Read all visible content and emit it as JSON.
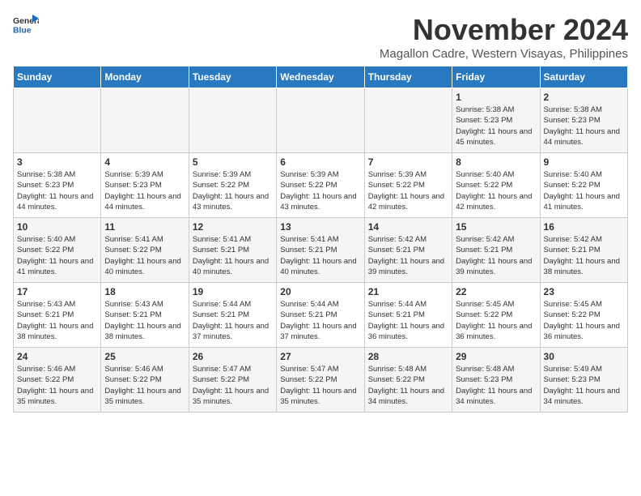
{
  "logo": {
    "line1": "General",
    "line2": "Blue"
  },
  "title": "November 2024",
  "location": "Magallon Cadre, Western Visayas, Philippines",
  "weekdays": [
    "Sunday",
    "Monday",
    "Tuesday",
    "Wednesday",
    "Thursday",
    "Friday",
    "Saturday"
  ],
  "weeks": [
    [
      {
        "day": "",
        "info": ""
      },
      {
        "day": "",
        "info": ""
      },
      {
        "day": "",
        "info": ""
      },
      {
        "day": "",
        "info": ""
      },
      {
        "day": "",
        "info": ""
      },
      {
        "day": "1",
        "info": "Sunrise: 5:38 AM\nSunset: 5:23 PM\nDaylight: 11 hours and 45 minutes."
      },
      {
        "day": "2",
        "info": "Sunrise: 5:38 AM\nSunset: 5:23 PM\nDaylight: 11 hours and 44 minutes."
      }
    ],
    [
      {
        "day": "3",
        "info": "Sunrise: 5:38 AM\nSunset: 5:23 PM\nDaylight: 11 hours and 44 minutes."
      },
      {
        "day": "4",
        "info": "Sunrise: 5:39 AM\nSunset: 5:23 PM\nDaylight: 11 hours and 44 minutes."
      },
      {
        "day": "5",
        "info": "Sunrise: 5:39 AM\nSunset: 5:22 PM\nDaylight: 11 hours and 43 minutes."
      },
      {
        "day": "6",
        "info": "Sunrise: 5:39 AM\nSunset: 5:22 PM\nDaylight: 11 hours and 43 minutes."
      },
      {
        "day": "7",
        "info": "Sunrise: 5:39 AM\nSunset: 5:22 PM\nDaylight: 11 hours and 42 minutes."
      },
      {
        "day": "8",
        "info": "Sunrise: 5:40 AM\nSunset: 5:22 PM\nDaylight: 11 hours and 42 minutes."
      },
      {
        "day": "9",
        "info": "Sunrise: 5:40 AM\nSunset: 5:22 PM\nDaylight: 11 hours and 41 minutes."
      }
    ],
    [
      {
        "day": "10",
        "info": "Sunrise: 5:40 AM\nSunset: 5:22 PM\nDaylight: 11 hours and 41 minutes."
      },
      {
        "day": "11",
        "info": "Sunrise: 5:41 AM\nSunset: 5:22 PM\nDaylight: 11 hours and 40 minutes."
      },
      {
        "day": "12",
        "info": "Sunrise: 5:41 AM\nSunset: 5:21 PM\nDaylight: 11 hours and 40 minutes."
      },
      {
        "day": "13",
        "info": "Sunrise: 5:41 AM\nSunset: 5:21 PM\nDaylight: 11 hours and 40 minutes."
      },
      {
        "day": "14",
        "info": "Sunrise: 5:42 AM\nSunset: 5:21 PM\nDaylight: 11 hours and 39 minutes."
      },
      {
        "day": "15",
        "info": "Sunrise: 5:42 AM\nSunset: 5:21 PM\nDaylight: 11 hours and 39 minutes."
      },
      {
        "day": "16",
        "info": "Sunrise: 5:42 AM\nSunset: 5:21 PM\nDaylight: 11 hours and 38 minutes."
      }
    ],
    [
      {
        "day": "17",
        "info": "Sunrise: 5:43 AM\nSunset: 5:21 PM\nDaylight: 11 hours and 38 minutes."
      },
      {
        "day": "18",
        "info": "Sunrise: 5:43 AM\nSunset: 5:21 PM\nDaylight: 11 hours and 38 minutes."
      },
      {
        "day": "19",
        "info": "Sunrise: 5:44 AM\nSunset: 5:21 PM\nDaylight: 11 hours and 37 minutes."
      },
      {
        "day": "20",
        "info": "Sunrise: 5:44 AM\nSunset: 5:21 PM\nDaylight: 11 hours and 37 minutes."
      },
      {
        "day": "21",
        "info": "Sunrise: 5:44 AM\nSunset: 5:21 PM\nDaylight: 11 hours and 36 minutes."
      },
      {
        "day": "22",
        "info": "Sunrise: 5:45 AM\nSunset: 5:22 PM\nDaylight: 11 hours and 36 minutes."
      },
      {
        "day": "23",
        "info": "Sunrise: 5:45 AM\nSunset: 5:22 PM\nDaylight: 11 hours and 36 minutes."
      }
    ],
    [
      {
        "day": "24",
        "info": "Sunrise: 5:46 AM\nSunset: 5:22 PM\nDaylight: 11 hours and 35 minutes."
      },
      {
        "day": "25",
        "info": "Sunrise: 5:46 AM\nSunset: 5:22 PM\nDaylight: 11 hours and 35 minutes."
      },
      {
        "day": "26",
        "info": "Sunrise: 5:47 AM\nSunset: 5:22 PM\nDaylight: 11 hours and 35 minutes."
      },
      {
        "day": "27",
        "info": "Sunrise: 5:47 AM\nSunset: 5:22 PM\nDaylight: 11 hours and 35 minutes."
      },
      {
        "day": "28",
        "info": "Sunrise: 5:48 AM\nSunset: 5:22 PM\nDaylight: 11 hours and 34 minutes."
      },
      {
        "day": "29",
        "info": "Sunrise: 5:48 AM\nSunset: 5:23 PM\nDaylight: 11 hours and 34 minutes."
      },
      {
        "day": "30",
        "info": "Sunrise: 5:49 AM\nSunset: 5:23 PM\nDaylight: 11 hours and 34 minutes."
      }
    ]
  ]
}
